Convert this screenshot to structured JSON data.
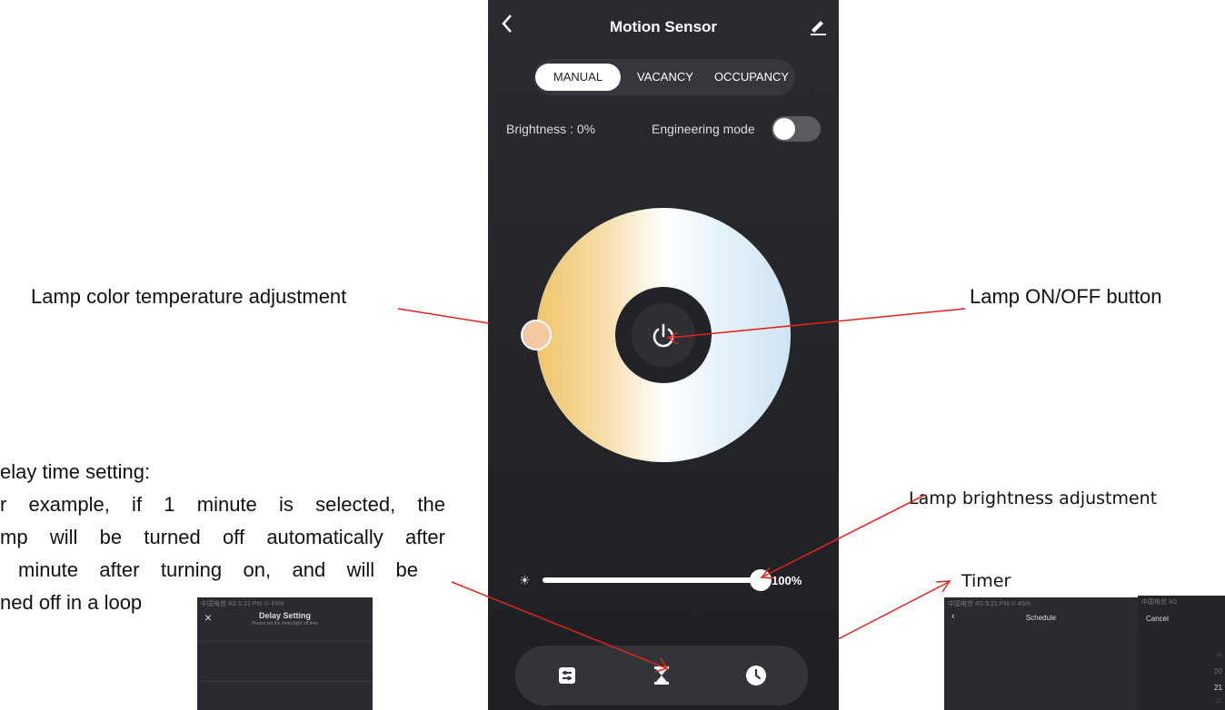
{
  "phone": {
    "title": "Motion Sensor",
    "back_icon": "chevron-left-icon",
    "edit_icon": "pencil-icon",
    "tabs": [
      "MANUAL",
      "VACANCY",
      "OCCUPANCY"
    ],
    "active_tab": "MANUAL",
    "brightness_label": "Brightness : 0%",
    "engineering_mode_label": "Engineering mode",
    "engineering_mode_on": false,
    "power_icon": "power-icon",
    "sun_icon": "sun-icon",
    "slider_value_label": "100%",
    "slider_value": 100,
    "bottom_icons": [
      "settings-sliders-icon",
      "hourglass-icon",
      "clock-icon"
    ]
  },
  "annotations": {
    "color_temp": "Lamp color temperature adjustment",
    "onoff": "Lamp ON/OFF button",
    "brightness": "Lamp brightness adjustment",
    "timer": "Timer",
    "delay_lines": [
      "elay time setting:",
      "r example, if 1 minute is selected, the",
      "mp will be turned off automatically after",
      "minute after turning on, and will be",
      "ned off in a loop"
    ]
  },
  "delay_thumbnail": {
    "status": "中国电信 4G          5:21 PM          ⊙ 45%",
    "title": "Delay Setting",
    "subtitle": "Please set the delay light off time",
    "close_icon": "close-icon"
  },
  "schedule_thumbnail": {
    "status": "中国电信 4G          5:21 PM          ⊙ 45%",
    "title": "Schedule",
    "back_icon": "chevron-left-icon"
  },
  "picker_thumbnail": {
    "status": "中国电信 4G",
    "cancel": "Cancel",
    "numbers": [
      "19",
      "20",
      "21",
      "22"
    ]
  },
  "colors": {
    "phone_bg": "#232428",
    "annotation_arrow": "#e0231c"
  }
}
